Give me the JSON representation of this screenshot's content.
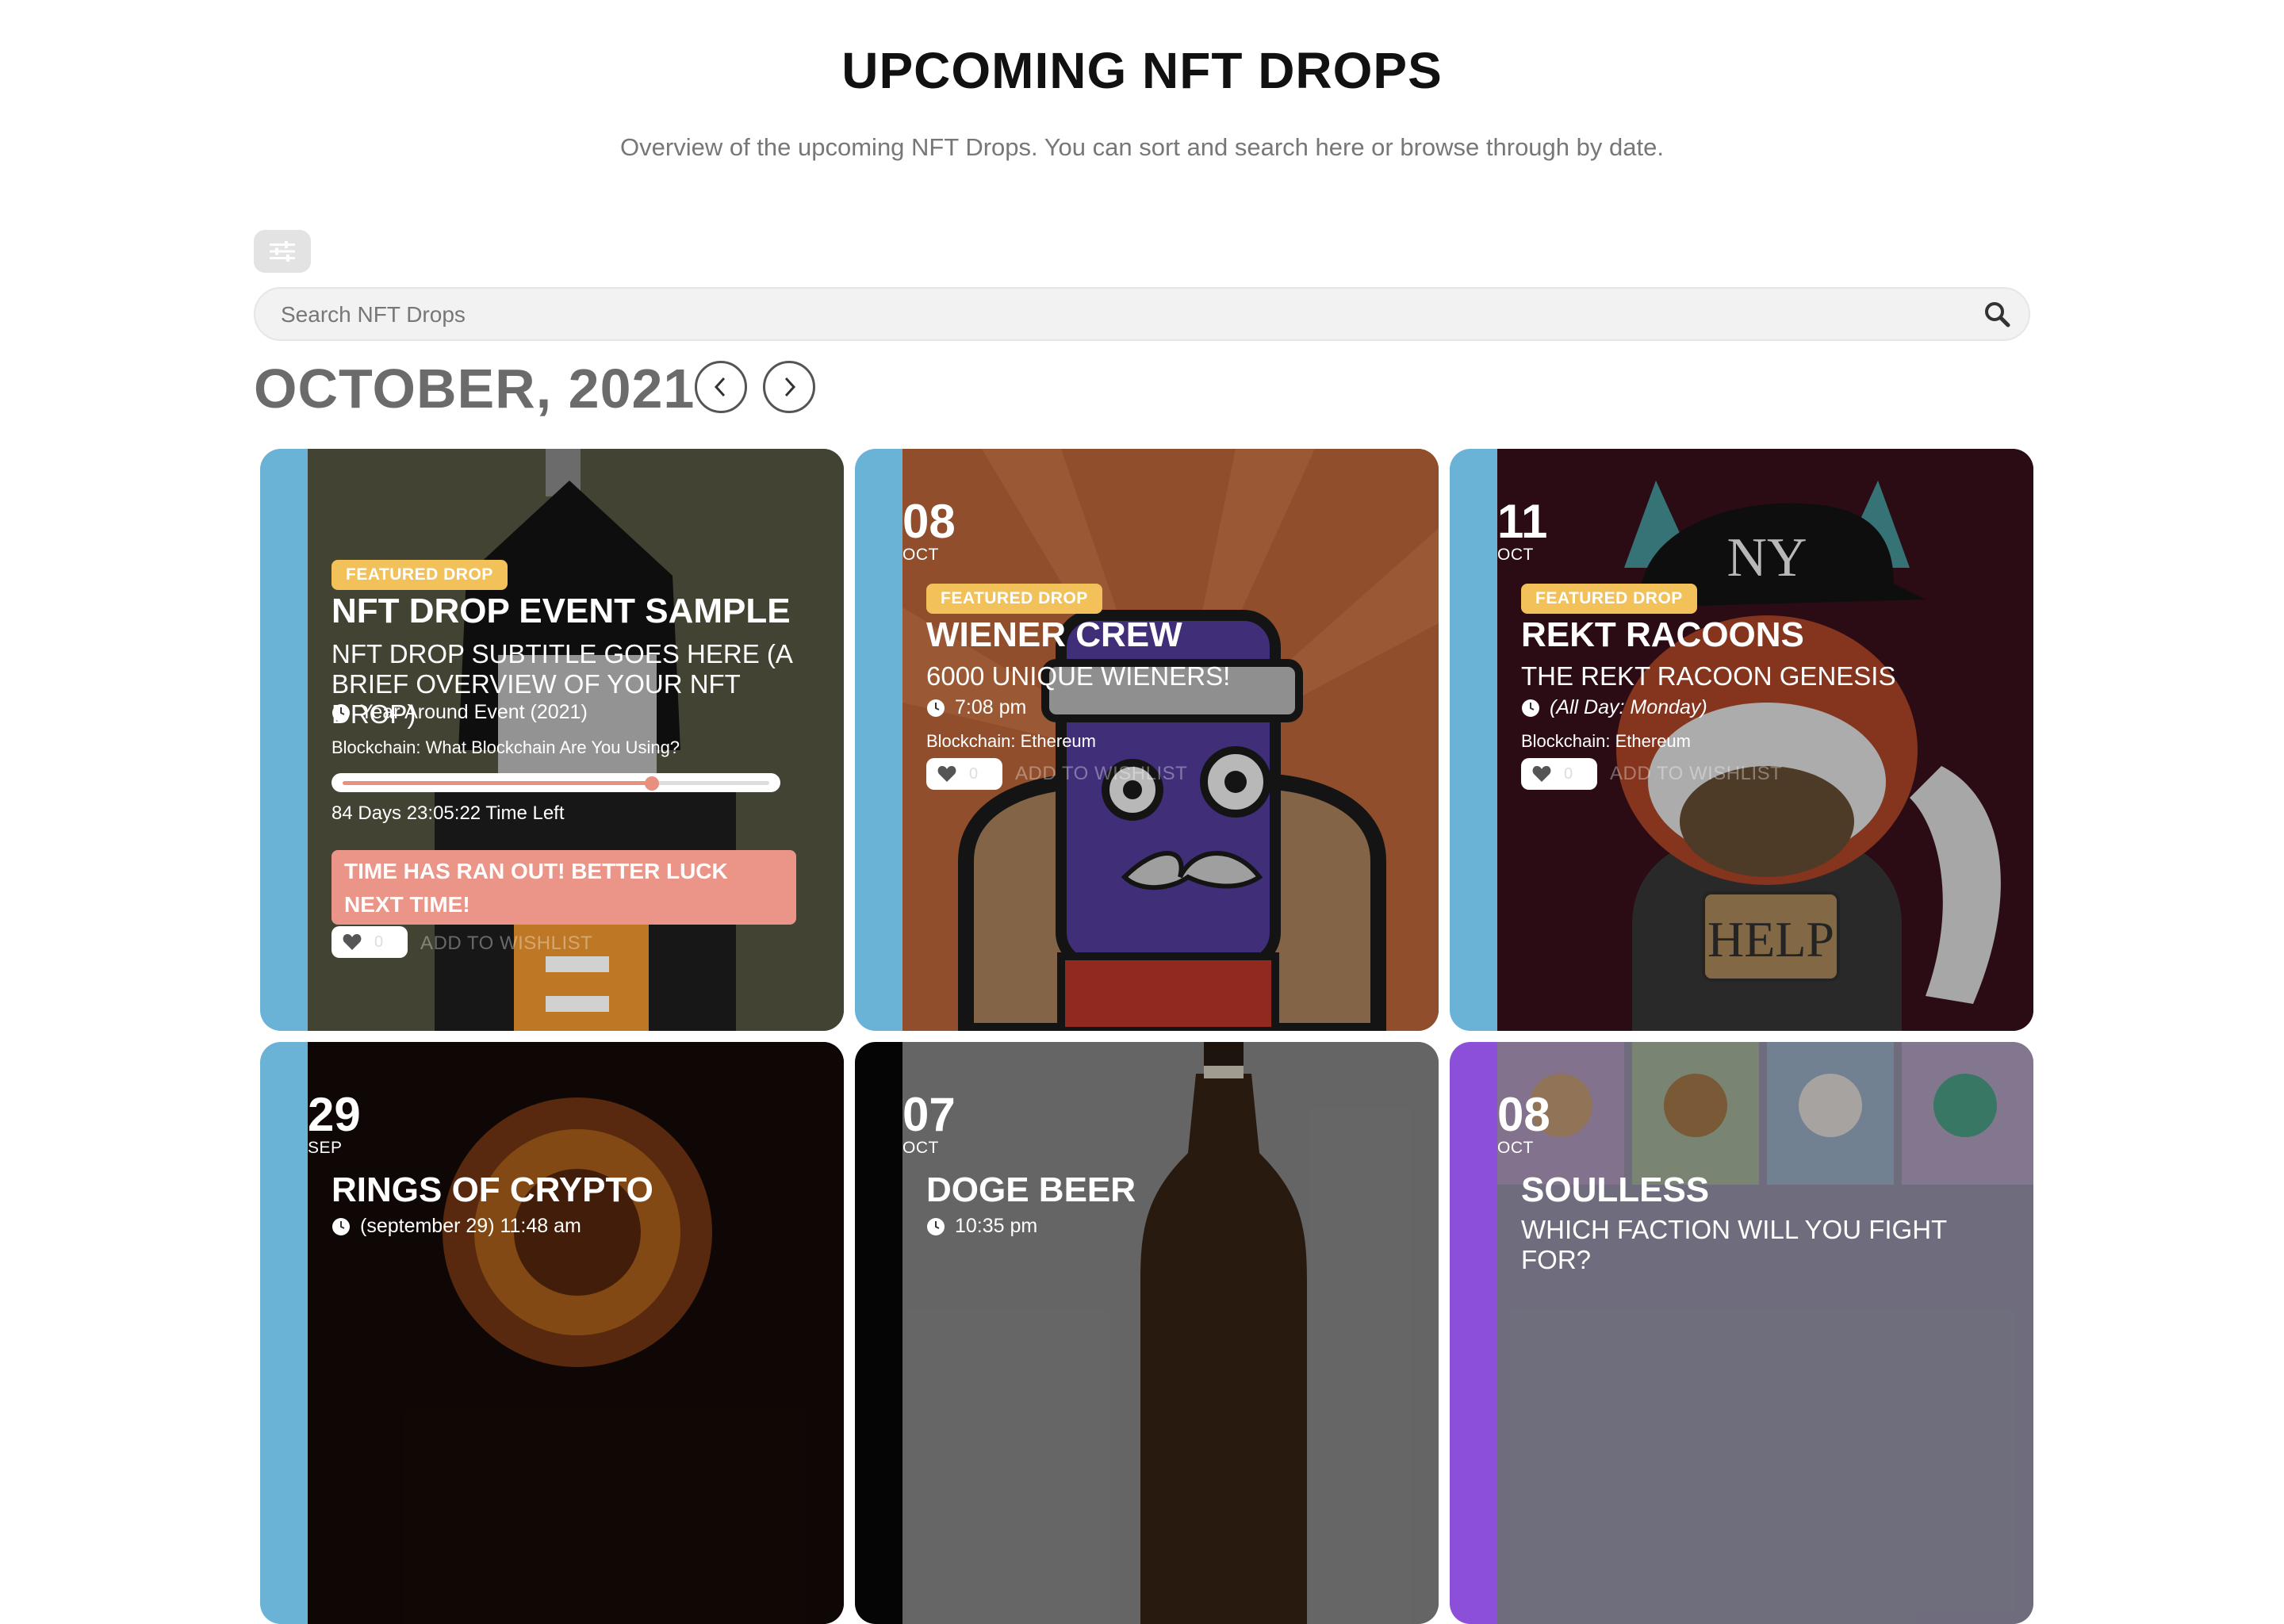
{
  "page": {
    "title": "UPCOMING NFT DROPS",
    "subtitle": "Overview of the upcoming NFT Drops. You can sort and search here or browse through by date."
  },
  "search": {
    "placeholder": "Search NFT Drops"
  },
  "calendar": {
    "month_label": "OCTOBER, 2021"
  },
  "colors": {
    "stripe_blue": "#6ab3d6",
    "badge_yellow": "#f2c15a",
    "expired_pink": "#ea9588",
    "soulless_purple": "#8c4fd8"
  },
  "cards": [
    {
      "badge": "FEATURED DROP",
      "title": "NFT DROP EVENT SAMPLE",
      "subtitle": "NFT DROP SUBTITLE GOES HERE (A BRIEF OVERVIEW OF YOUR NFT DROP)",
      "time": "Year Around Event (2021)",
      "blockchain": "Blockchain:  What Blockchain Are You Using?",
      "progress": 0.71,
      "time_left": "84 Days 23:05:22 Time Left",
      "expired_message": "TIME HAS RAN OUT! BETTER LUCK NEXT TIME!",
      "wishlist_count": "0",
      "wishlist_label": "ADD TO WISHLIST"
    },
    {
      "day": "08",
      "month": "OCT",
      "badge": "FEATURED DROP",
      "title": "WIENER CREW",
      "subtitle": "6000 UNIQUE WIENERS!",
      "time": "7:08 pm",
      "blockchain": "Blockchain:  Ethereum",
      "wishlist_count": "0",
      "wishlist_label": "ADD TO WISHLIST"
    },
    {
      "day": "11",
      "month": "OCT",
      "badge": "FEATURED DROP",
      "title": "REKT RACOONS",
      "subtitle": "THE REKT RACOON GENESIS",
      "time": "(All Day: Monday)",
      "blockchain": "Blockchain:  Ethereum",
      "wishlist_count": "0",
      "wishlist_label": "ADD TO WISHLIST"
    },
    {
      "day": "29",
      "month": "SEP",
      "title": "RINGS OF CRYPTO",
      "time": "(september 29) 11:48 am"
    },
    {
      "day": "07",
      "month": "OCT",
      "title": "DOGE BEER",
      "time": "10:35 pm"
    },
    {
      "day": "08",
      "month": "OCT",
      "title": "SOULLESS",
      "subtitle": "WHICH FACTION WILL YOU FIGHT FOR?"
    }
  ]
}
